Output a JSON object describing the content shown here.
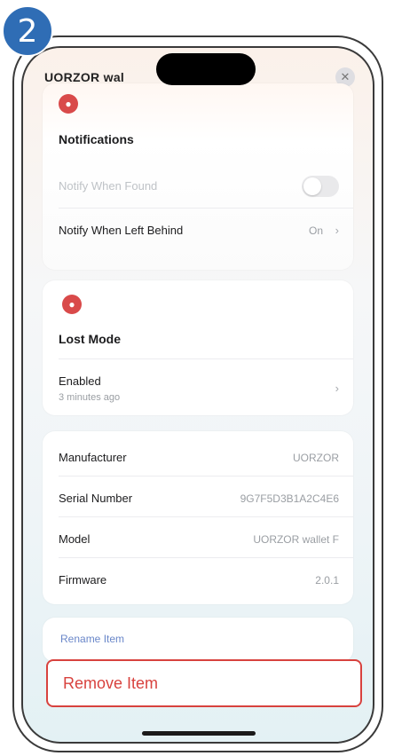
{
  "step": "2",
  "header": {
    "title": "UORZOR wal",
    "close_symbol": "✕"
  },
  "notifications": {
    "title": "Notifications",
    "rows": [
      {
        "label": "Notify When Found",
        "enabled": false
      },
      {
        "label": "Notify When Left Behind",
        "value": "On"
      }
    ]
  },
  "lost_mode": {
    "title": "Lost Mode",
    "enabled_label": "Enabled",
    "enabled_sub": "3 minutes ago"
  },
  "info": {
    "rows": [
      {
        "label": "Manufacturer",
        "value": "UORZOR"
      },
      {
        "label": "Serial Number",
        "value": "9G7F5D3B1A2C4E6"
      },
      {
        "label": "Model",
        "value": "UORZOR wallet F"
      },
      {
        "label": "Firmware",
        "value": "2.0.1"
      }
    ]
  },
  "actions": {
    "rename": "Rename Item",
    "remove": "Remove Item"
  },
  "colors": {
    "badge": "#2f6db5",
    "remove": "#d8423e",
    "section_icon": "#d94a4a"
  }
}
